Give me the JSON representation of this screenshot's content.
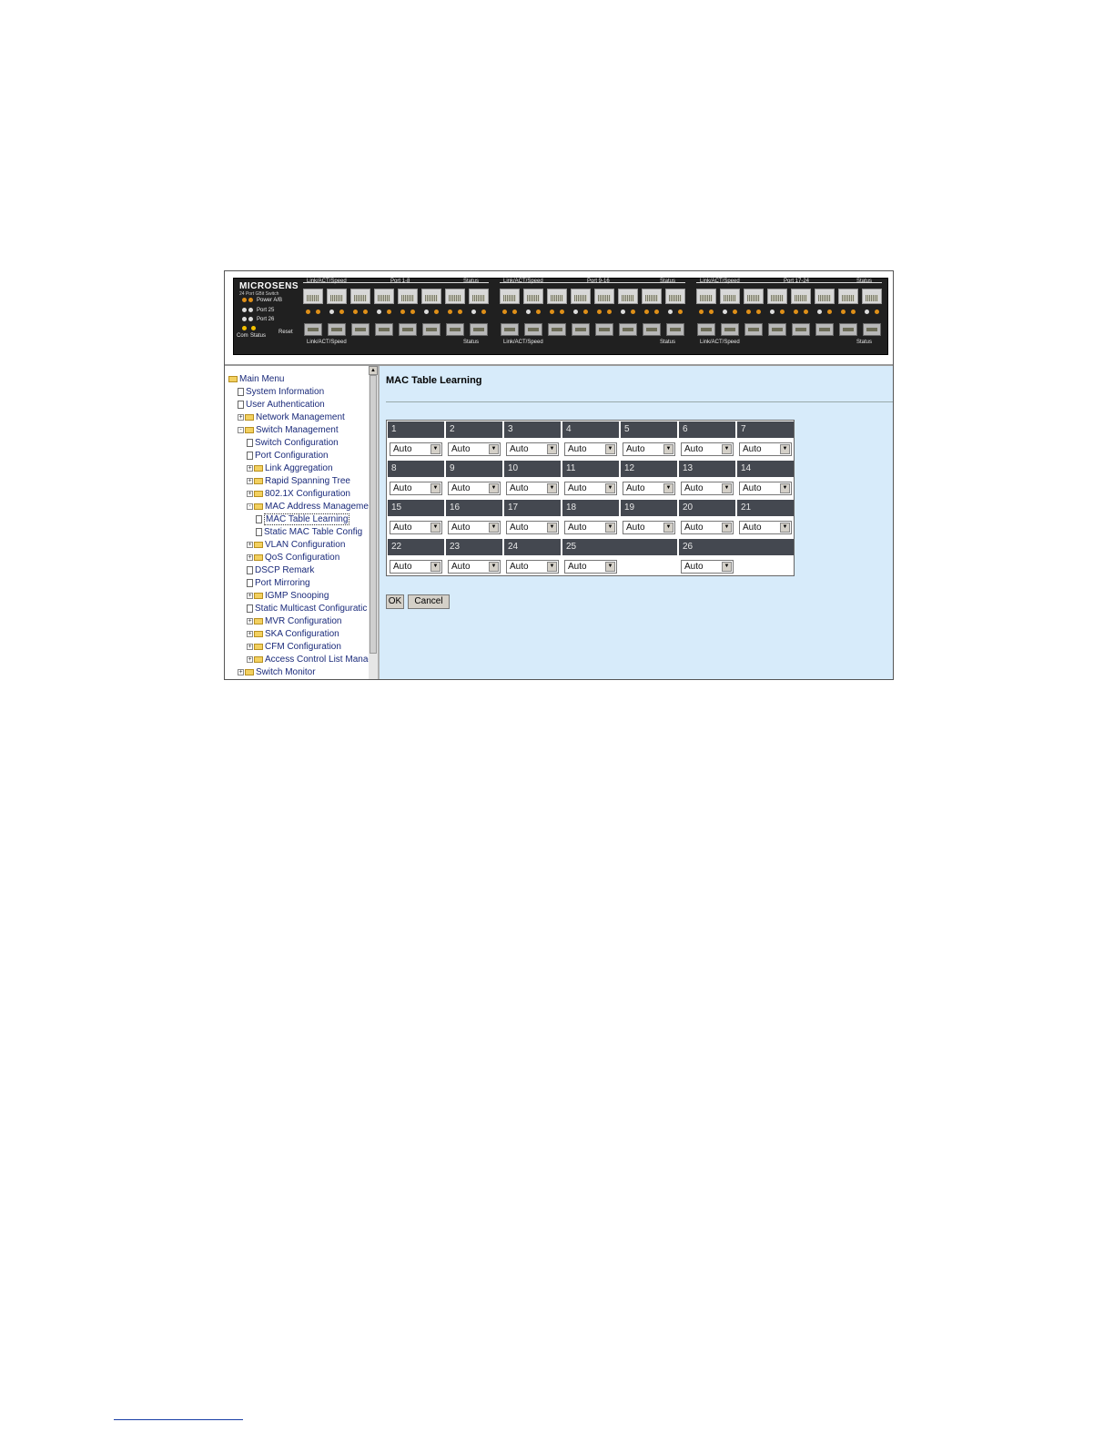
{
  "panel": {
    "brand": "MICROSENS",
    "subbrand": "24 Port GBit Switch",
    "power_label": "Power A/B",
    "port25_label": "Port 25",
    "port26_label": "Port 26",
    "com_label": "Com",
    "status_label": "Status",
    "reset_label": "Reset",
    "groups": [
      {
        "top_left": "Link/ACT/Speed",
        "top_mid": "Port 1-8",
        "top_right": "Status",
        "bottom_left": "Link/ACT/Speed",
        "bottom_right": "Status"
      },
      {
        "top_left": "Link/ACT/Speed",
        "top_mid": "Port 9-16",
        "top_right": "Status",
        "bottom_left": "Link/ACT/Speed",
        "bottom_right": "Status"
      },
      {
        "top_left": "Link/ACT/Speed",
        "top_mid": "Port 17-24",
        "top_right": "Status",
        "bottom_left": "Link/ACT/Speed",
        "bottom_right": "Status"
      }
    ],
    "colors": {
      "panel_bg": "#202020",
      "led_amber": "#e09018",
      "led_white": "#dddddd",
      "led_yellow": "#f3c000"
    }
  },
  "sidebar": {
    "items": [
      {
        "label": "Main Menu",
        "icon": "folder-open-icon",
        "expander": ""
      },
      {
        "label": "System Information",
        "icon": "page-icon",
        "expander": ""
      },
      {
        "label": "User Authentication",
        "icon": "page-icon",
        "expander": ""
      },
      {
        "label": "Network Management",
        "icon": "folder-icon",
        "expander": "+"
      },
      {
        "label": "Switch Management",
        "icon": "folder-open-icon",
        "expander": "-"
      },
      {
        "label": "Switch Configuration",
        "icon": "page-icon",
        "expander": ""
      },
      {
        "label": "Port Configuration",
        "icon": "page-icon",
        "expander": ""
      },
      {
        "label": "Link Aggregation",
        "icon": "folder-icon",
        "expander": "+"
      },
      {
        "label": "Rapid Spanning Tree",
        "icon": "folder-icon",
        "expander": "+"
      },
      {
        "label": "802.1X Configuration",
        "icon": "folder-icon",
        "expander": "+"
      },
      {
        "label": "MAC Address Managemen",
        "icon": "folder-open-icon",
        "expander": "-"
      },
      {
        "label": "MAC Table Learning",
        "icon": "page-icon",
        "expander": ""
      },
      {
        "label": "Static MAC Table Config",
        "icon": "page-icon",
        "expander": ""
      },
      {
        "label": "VLAN Configuration",
        "icon": "folder-icon",
        "expander": "+"
      },
      {
        "label": "QoS Configuration",
        "icon": "folder-icon",
        "expander": "+"
      },
      {
        "label": "DSCP Remark",
        "icon": "page-icon",
        "expander": ""
      },
      {
        "label": "Port Mirroring",
        "icon": "page-icon",
        "expander": ""
      },
      {
        "label": "IGMP Snooping",
        "icon": "folder-icon",
        "expander": "+"
      },
      {
        "label": "Static Multicast Configuratic",
        "icon": "page-icon",
        "expander": ""
      },
      {
        "label": "MVR Configuration",
        "icon": "folder-icon",
        "expander": "+"
      },
      {
        "label": "SKA Configuration",
        "icon": "folder-icon",
        "expander": "+"
      },
      {
        "label": "CFM Configuration",
        "icon": "folder-icon",
        "expander": "+"
      },
      {
        "label": "Access Control List Manage",
        "icon": "folder-icon",
        "expander": "+"
      },
      {
        "label": "Switch Monitor",
        "icon": "folder-icon",
        "expander": "+"
      }
    ],
    "selected": "MAC Table Learning"
  },
  "main": {
    "title": "MAC Table Learning",
    "ports": [
      {
        "port": "1",
        "value": "Auto"
      },
      {
        "port": "2",
        "value": "Auto"
      },
      {
        "port": "3",
        "value": "Auto"
      },
      {
        "port": "4",
        "value": "Auto"
      },
      {
        "port": "5",
        "value": "Auto"
      },
      {
        "port": "6",
        "value": "Auto"
      },
      {
        "port": "7",
        "value": "Auto"
      },
      {
        "port": "8",
        "value": "Auto"
      },
      {
        "port": "9",
        "value": "Auto"
      },
      {
        "port": "10",
        "value": "Auto"
      },
      {
        "port": "11",
        "value": "Auto"
      },
      {
        "port": "12",
        "value": "Auto"
      },
      {
        "port": "13",
        "value": "Auto"
      },
      {
        "port": "14",
        "value": "Auto"
      },
      {
        "port": "15",
        "value": "Auto"
      },
      {
        "port": "16",
        "value": "Auto"
      },
      {
        "port": "17",
        "value": "Auto"
      },
      {
        "port": "18",
        "value": "Auto"
      },
      {
        "port": "19",
        "value": "Auto"
      },
      {
        "port": "20",
        "value": "Auto"
      },
      {
        "port": "21",
        "value": "Auto"
      },
      {
        "port": "22",
        "value": "Auto"
      },
      {
        "port": "23",
        "value": "Auto"
      },
      {
        "port": "24",
        "value": "Auto"
      },
      {
        "port": "25",
        "value": "Auto"
      },
      {
        "port": "26",
        "value": "Auto"
      }
    ],
    "ok_label": "OK",
    "cancel_label": "Cancel"
  }
}
